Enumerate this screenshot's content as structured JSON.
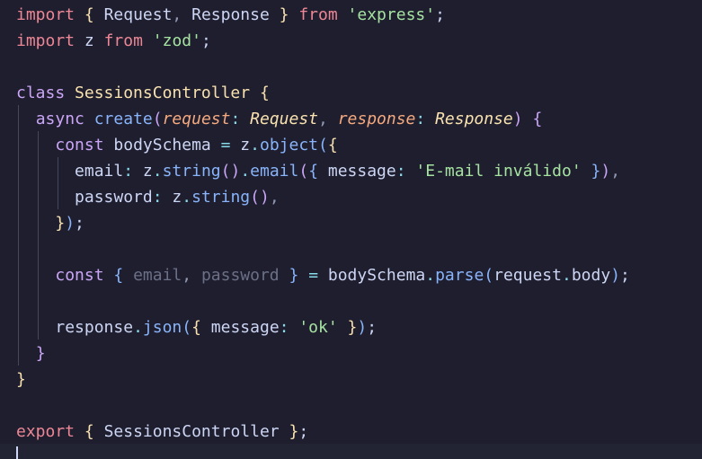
{
  "editor": {
    "language": "typescript",
    "lines": [
      "import { Request, Response } from 'express';",
      "import z from 'zod';",
      "",
      "class SessionsController {",
      "  async create(request: Request, response: Response) {",
      "    const bodySchema = z.object({",
      "      email: z.string().email({ message: 'E-mail inválido' }),",
      "      password: z.string(),",
      "    });",
      "",
      "    const { email, password } = bodySchema.parse(request.body);",
      "",
      "    response.json({ message: 'ok' });",
      "  }",
      "}",
      "",
      "export { SessionsController };",
      ""
    ]
  }
}
